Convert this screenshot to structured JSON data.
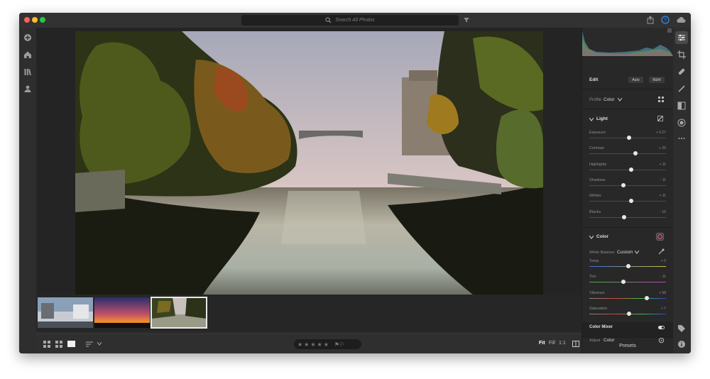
{
  "search": {
    "placeholder": "Search All Photos"
  },
  "toolbar": {
    "icons": [
      "share-icon",
      "help-icon",
      "cloud-icon"
    ]
  },
  "left_nav": {
    "icons": [
      "add-icon",
      "home-icon",
      "library-icon",
      "people-icon"
    ]
  },
  "bottom": {
    "zoom": {
      "fit": "Fit",
      "fill": "Fill",
      "one_to_one": "1:1"
    },
    "rating_stars": "★★★★★",
    "flags": "⚑⚐"
  },
  "panel": {
    "title": "Edit",
    "auto_label": "Auto",
    "bw_label": "B&W",
    "profile_label": "Profile",
    "profile_value": "Color",
    "light": {
      "title": "Light",
      "sliders": [
        {
          "label": "Exposure",
          "value": "+ 0.27",
          "pos": 0.52
        },
        {
          "label": "Contrast",
          "value": "+ 20",
          "pos": 0.6
        },
        {
          "label": "Highlights",
          "value": "+ 11",
          "pos": 0.55
        },
        {
          "label": "Shadows",
          "value": "- 11",
          "pos": 0.44
        },
        {
          "label": "Whites",
          "value": "+ 11",
          "pos": 0.55
        },
        {
          "label": "Blacks",
          "value": "- 10",
          "pos": 0.45
        }
      ]
    },
    "color": {
      "title": "Color",
      "wb_label": "White Balance",
      "wb_value": "Custom",
      "sliders": [
        {
          "label": "Temp",
          "value": "+ 2",
          "pos": 0.51
        },
        {
          "label": "Tint",
          "value": "- 11",
          "pos": 0.44
        },
        {
          "label": "Vibrance",
          "value": "+ 58",
          "pos": 0.75
        },
        {
          "label": "Saturation",
          "value": "+ 7",
          "pos": 0.52
        }
      ]
    },
    "mixer": {
      "title": "Color Mixer",
      "adjust_label": "Adjust",
      "adjust_value": "Color"
    },
    "presets_label": "Presets"
  },
  "right_nav": {
    "icons": [
      "edit-sliders-icon",
      "crop-icon",
      "healing-icon",
      "brush-icon",
      "linear-gradient-icon",
      "radial-gradient-icon",
      "more-icon",
      "tag-icon",
      "info-icon"
    ]
  }
}
